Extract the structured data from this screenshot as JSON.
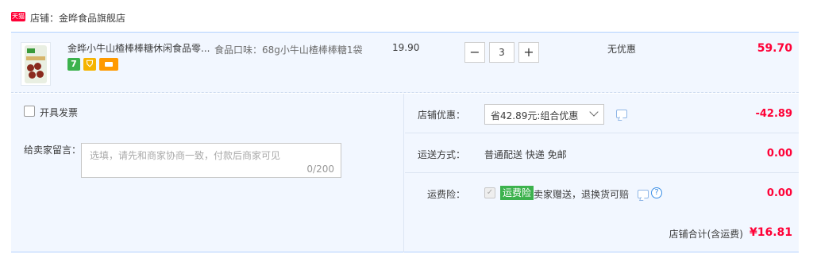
{
  "shop": {
    "badge": "天猫",
    "name": "店铺：金晔食品旗舰店"
  },
  "item": {
    "title": "金晔小牛山楂棒棒糖休闲食品零...",
    "sku": "食品口味：68g小牛山楂棒棒糖1袋",
    "unit_price": "19.90",
    "quantity": "3",
    "minus": "−",
    "plus": "+",
    "discount": "无优惠",
    "total": "59.70",
    "badges": {
      "seven": "7",
      "shield": "⛉"
    }
  },
  "invoice": {
    "label": "开具发票"
  },
  "message": {
    "label": "给卖家留言：",
    "placeholder": "选填，请先和商家协商一致，付款后商家可见",
    "count": "0/200"
  },
  "promo": {
    "label": "店铺优惠：",
    "selected": "省42.89元:组合优惠",
    "amount": "-42.89"
  },
  "shipping": {
    "label": "运送方式：",
    "value": "普通配送 快递 免邮",
    "amount": "0.00"
  },
  "insurance": {
    "label": "运费险：",
    "tag": "运费险",
    "text": "卖家赠送，退换货可赔",
    "amount": "0.00",
    "check": "✓",
    "help": "?"
  },
  "grand_total": {
    "label": "店铺合计(含运费)",
    "amount": "¥16.81"
  },
  "colors": {
    "price_red": "#ff0036",
    "row_blue": "#f2f7ff",
    "border_blue": "#b2d1ff",
    "insurance_green": "#3cb24d"
  }
}
